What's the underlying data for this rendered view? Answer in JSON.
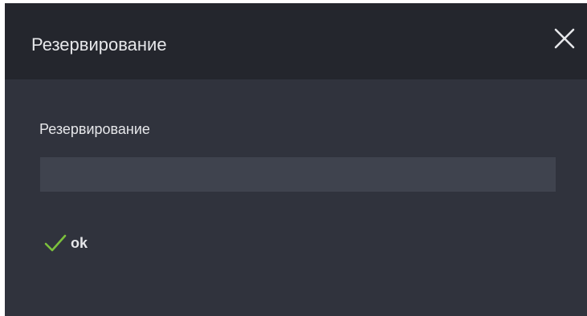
{
  "dialog": {
    "title": "Резервирование",
    "close_icon": "close-icon"
  },
  "form": {
    "field_label": "Резервирование",
    "field_value": "",
    "field_placeholder": ""
  },
  "status": {
    "icon": "checkmark-icon",
    "icon_color": "#7cc13c",
    "text": "ok"
  },
  "colors": {
    "header_background": "#24262d",
    "body_background": "#30333d",
    "input_background": "#3f434e",
    "text": "#e6e7ea"
  }
}
